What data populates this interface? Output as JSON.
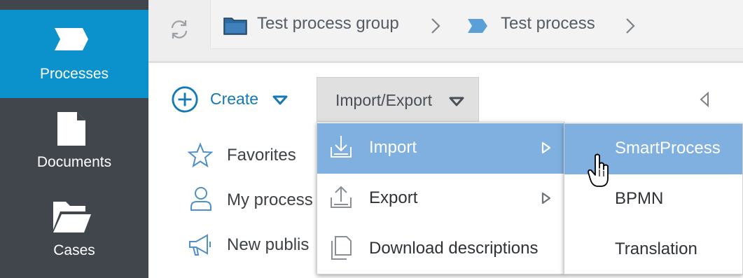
{
  "sidebar": {
    "items": [
      {
        "label": "Processes",
        "icon": "process-chevron-icon",
        "active": true
      },
      {
        "label": "Documents",
        "icon": "document-icon",
        "active": false
      },
      {
        "label": "Cases",
        "icon": "folder-open-icon",
        "active": false
      }
    ]
  },
  "topbar": {
    "refresh_icon": "refresh-icon",
    "breadcrumb": [
      {
        "label": "Test process group",
        "icon": "folder-icon"
      },
      {
        "label": "Test process",
        "icon": "process-chevron-icon"
      }
    ]
  },
  "toolbar": {
    "create_label": "Create",
    "import_export_label": "Import/Export"
  },
  "nav_list": [
    {
      "label": "Favorites",
      "icon": "star-icon"
    },
    {
      "label": "My process",
      "icon": "user-icon"
    },
    {
      "label": "New publis",
      "icon": "megaphone-icon"
    }
  ],
  "menu": {
    "items": [
      {
        "label": "Import",
        "icon": "import-icon",
        "has_submenu": true,
        "highlighted": true
      },
      {
        "label": "Export",
        "icon": "export-icon",
        "has_submenu": true,
        "highlighted": false
      },
      {
        "label": "Download descriptions",
        "icon": "documents-icon",
        "has_submenu": false,
        "highlighted": false
      }
    ]
  },
  "submenu": {
    "items": [
      {
        "label": "SmartProcess",
        "highlighted": true
      },
      {
        "label": "BPMN",
        "highlighted": false
      },
      {
        "label": "Translation",
        "highlighted": false
      }
    ]
  },
  "colors": {
    "sidebar_bg": "#41464c",
    "sidebar_active": "#0b91cc",
    "accent": "#1479b8",
    "menu_highlight": "#7fb0e0"
  }
}
